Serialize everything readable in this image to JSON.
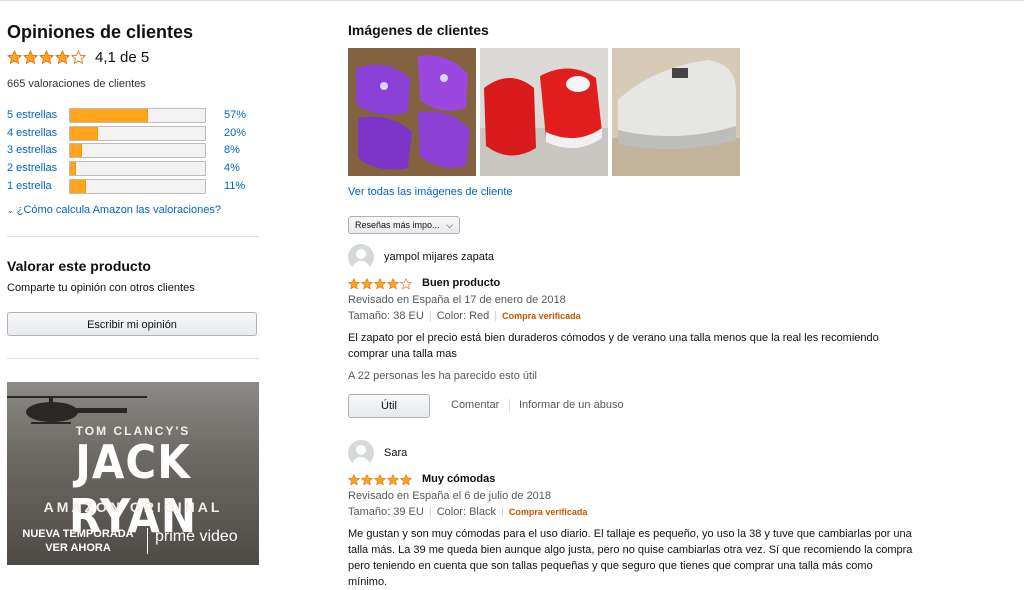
{
  "summary": {
    "title": "Opiniones de clientes",
    "stars": 4.1,
    "rating_text": "4,1 de 5",
    "total": "665 valoraciones de clientes",
    "histogram": [
      {
        "label": "5 estrellas",
        "percent": 57,
        "pct_label": "57%"
      },
      {
        "label": "4 estrellas",
        "percent": 20,
        "pct_label": "20%"
      },
      {
        "label": "3 estrellas",
        "percent": 8,
        "pct_label": "8%"
      },
      {
        "label": "2 estrellas",
        "percent": 4,
        "pct_label": "4%"
      },
      {
        "label": "1 estrella",
        "percent": 11,
        "pct_label": "11%"
      }
    ],
    "how_link": "¿Cómo calcula Amazon las valoraciones?"
  },
  "rate": {
    "title": "Valorar este producto",
    "subtitle": "Comparte tu opinión con otros clientes",
    "button": "Escribir mi opinión"
  },
  "ad": {
    "line1": "TOM CLANCY'S",
    "line2": "JACK RYAN",
    "line3": "AMAZON ORIGINAL",
    "line4a": "NUEVA TEMPORADA",
    "line4b": "VER AHORA",
    "brand": "prime video"
  },
  "images": {
    "title": "Imágenes de clientes",
    "see_all": "Ver todas las imágenes de cliente"
  },
  "sort": {
    "label": "Reseñas más impo..."
  },
  "reviews": [
    {
      "name": "yampol mijares zapata",
      "stars": 4,
      "title": "Buen producto",
      "date": "Revisado en España el 17 de enero de 2018",
      "size": "Tamaño: 38 EU",
      "color": "Color: Red",
      "verified": "Compra verificada",
      "body": "El zapato por el precio está bien duraderos cómodos y de verano una talla menos que la real les recomiendo comprar una talla mas",
      "helpful": "A 22 personas les ha parecido esto útil",
      "util": "Útil",
      "comment": "Comentar",
      "report": "Informar de un abuso"
    },
    {
      "name": "Sara",
      "stars": 5,
      "title": "Muy cómodas",
      "date": "Revisado en España el 6 de julio de 2018",
      "size": "Tamaño: 39 EU",
      "color": "Color: Black",
      "verified": "Compra verificada",
      "body": "Me gustan y son muy cómodas para el uso diario. El tallaje es pequeño, yo uso la 38 y tuve que cambiarlas por una talla más. La 39 me queda bien aunque algo justa, pero no quise cambiarlas otra vez. Sí que recomiendo la compra pero teniendo en cuenta que son tallas pequeñas y que seguro que tienes que comprar una talla más como mínimo."
    }
  ],
  "colors": {
    "star": "#ffa41c",
    "link": "#0066c0",
    "verified": "#c45500"
  }
}
